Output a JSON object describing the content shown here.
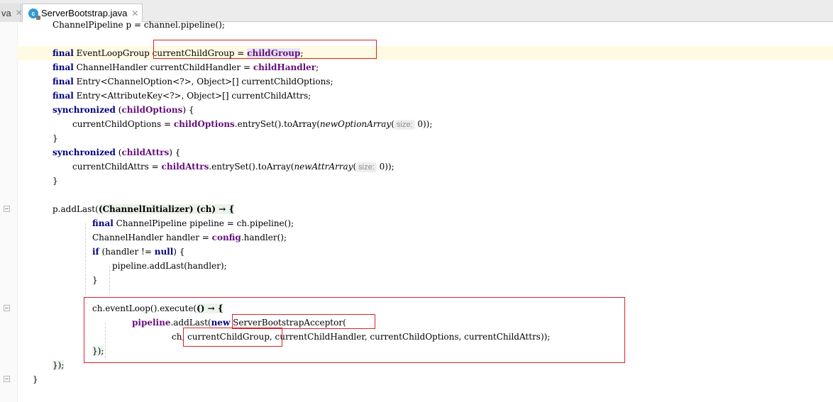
{
  "tabs": [
    {
      "label": "va",
      "close": "✕"
    },
    {
      "label": "ServerBootstrap.java",
      "close": "✕",
      "icon_letter": "c"
    }
  ],
  "colors": {
    "keyword": "#000080",
    "field": "#660e7a",
    "highlight_box": "#e0202a",
    "caret_line": "#fffae3"
  },
  "code": {
    "l0": {
      "t": "ChannelPipeline p = channel.pipeline();"
    },
    "l2": {
      "kw": "final",
      "a": " EventLoopGroup currentChildGroup = ",
      "fld": "childGroup",
      "b": ";"
    },
    "l3": {
      "kw": "final",
      "a": " ChannelHandler currentChildHandler = ",
      "fld": "childHandler",
      "b": ";"
    },
    "l4": {
      "kw": "final",
      "a": " Entry<ChannelOption<?>, Object>[] currentChildOptions;"
    },
    "l5": {
      "kw": "final",
      "a": " Entry<AttributeKey<?>, Object>[] currentChildAttrs;"
    },
    "l6": {
      "kw": "synchronized",
      "a": " (",
      "fld": "childOptions",
      "b": ") {"
    },
    "l7": {
      "a": "currentChildOptions = ",
      "fld": "childOptions",
      "b": ".entrySet().toArray(",
      "it": "newOptionArray",
      "c": "(",
      "hint": "size:",
      "d": " 0));"
    },
    "l8": {
      "t": "}"
    },
    "l9": {
      "kw": "synchronized",
      "a": " (",
      "fld": "childAttrs",
      "b": ") {"
    },
    "l10": {
      "a": "currentChildAttrs = ",
      "fld": "childAttrs",
      "b": ".entrySet().toArray(",
      "it": "newAttrArray",
      "c": "(",
      "hint": "size:",
      "d": " 0));"
    },
    "l11": {
      "t": "}"
    },
    "l13": {
      "a": "p.addLast(",
      "lam": "(ChannelInitializer) (ch) → {"
    },
    "l14": {
      "kw": "final",
      "a": " ChannelPipeline pipeline = ch.pipeline();"
    },
    "l15": {
      "a": "ChannelHandler handler = ",
      "fld": "config",
      "b": ".handler();"
    },
    "l16": {
      "kw": "if",
      "a": " (handler != ",
      "kw2": "null",
      "b": ") {"
    },
    "l17": {
      "t": "pipeline.addLast(handler);"
    },
    "l18": {
      "t": "}"
    },
    "l20": {
      "a": "ch.eventLoop().execute(",
      "lam": "() → {"
    },
    "l21": {
      "fld": "pipeline",
      "a": ".addLast(",
      "kw": "new",
      "b": " ServerBootstrapAcceptor("
    },
    "l22": {
      "t": "ch, currentChildGroup, currentChildHandler, currentChildOptions, currentChildAttrs));"
    },
    "l23": {
      "lam": "});"
    },
    "l24": {
      "lam": "});"
    },
    "l25": {
      "t": "}"
    }
  }
}
